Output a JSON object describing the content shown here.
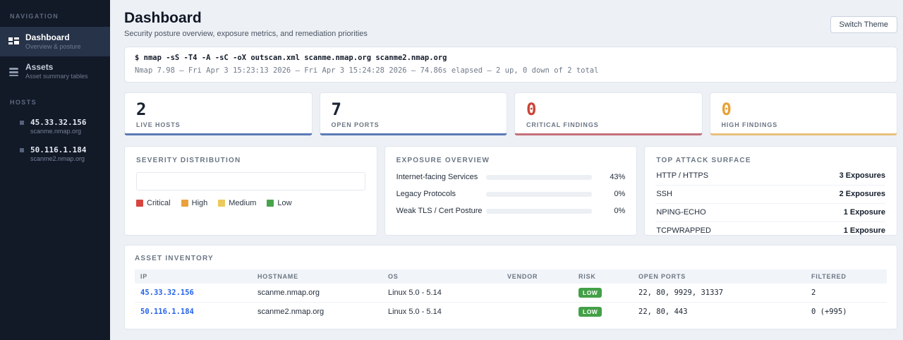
{
  "sidebar": {
    "nav_label": "NAVIGATION",
    "items": [
      {
        "label": "Dashboard",
        "sublabel": "Overview & posture"
      },
      {
        "label": "Assets",
        "sublabel": "Asset summary tables"
      }
    ],
    "hosts_label": "HOSTS",
    "hosts": [
      {
        "ip": "45.33.32.156",
        "hostname": "scanme.nmap.org"
      },
      {
        "ip": "50.116.1.184",
        "hostname": "scanme2.nmap.org"
      }
    ]
  },
  "header": {
    "title": "Dashboard",
    "subtitle": "Security posture overview, exposure metrics, and remediation priorities",
    "theme_button": "Switch Theme"
  },
  "command": {
    "cmd": "$ nmap -sS -T4 -A -sC -oX outscan.xml scanme.nmap.org scanme2.nmap.org",
    "meta": "Nmap 7.98 — Fri Apr 3 15:23:13 2026 — Fri Apr 3 15:24:28 2026 — 74.86s elapsed — 2 up, 0 down of 2 total"
  },
  "stats": [
    {
      "value": "2",
      "label": "LIVE HOSTS",
      "accent": "#5b7ab5",
      "value_color": "#1b2433"
    },
    {
      "value": "7",
      "label": "OPEN PORTS",
      "accent": "#5b7ab5",
      "value_color": "#1b2433"
    },
    {
      "value": "0",
      "label": "CRITICAL FINDINGS",
      "accent": "#c4707a",
      "value_color": "#cc4437"
    },
    {
      "value": "0",
      "label": "HIGH FINDINGS",
      "accent": "#e9c07e",
      "value_color": "#e6a23c"
    }
  ],
  "severity": {
    "title": "SEVERITY DISTRIBUTION",
    "legend": [
      {
        "label": "Critical",
        "color": "#d8453f"
      },
      {
        "label": "High",
        "color": "#e9a13b"
      },
      {
        "label": "Medium",
        "color": "#ecc95c"
      },
      {
        "label": "Low",
        "color": "#47a44b"
      }
    ]
  },
  "exposure": {
    "title": "EXPOSURE OVERVIEW",
    "bar_color": "#2f6bdb",
    "rows": [
      {
        "label": "Internet-facing Services",
        "pct": "43%"
      },
      {
        "label": "Legacy Protocols",
        "pct": "0%"
      },
      {
        "label": "Weak TLS / Cert Posture",
        "pct": "0%"
      }
    ]
  },
  "attack_surface": {
    "title": "TOP ATTACK SURFACE",
    "rows": [
      {
        "protocol": "HTTP / HTTPS",
        "count": "3 Exposures"
      },
      {
        "protocol": "SSH",
        "count": "2 Exposures"
      },
      {
        "protocol": "NPING-ECHO",
        "count": "1 Exposure"
      },
      {
        "protocol": "TCPWRAPPED",
        "count": "1 Exposure"
      }
    ]
  },
  "inventory": {
    "title": "ASSET INVENTORY",
    "headers": [
      "IP",
      "HOSTNAME",
      "OS",
      "VENDOR",
      "RISK",
      "OPEN PORTS",
      "FILTERED"
    ],
    "risk_badge_color": "#43a047",
    "rows": [
      {
        "ip": "45.33.32.156",
        "hostname": "scanme.nmap.org",
        "os": "Linux 5.0 - 5.14",
        "vendor": "",
        "risk": "LOW",
        "open_ports": "22, 80, 9929, 31337",
        "filtered": "2"
      },
      {
        "ip": "50.116.1.184",
        "hostname": "scanme2.nmap.org",
        "os": "Linux 5.0 - 5.14",
        "vendor": "",
        "risk": "LOW",
        "open_ports": "22, 80, 443",
        "filtered": "0 (+995)"
      }
    ]
  }
}
